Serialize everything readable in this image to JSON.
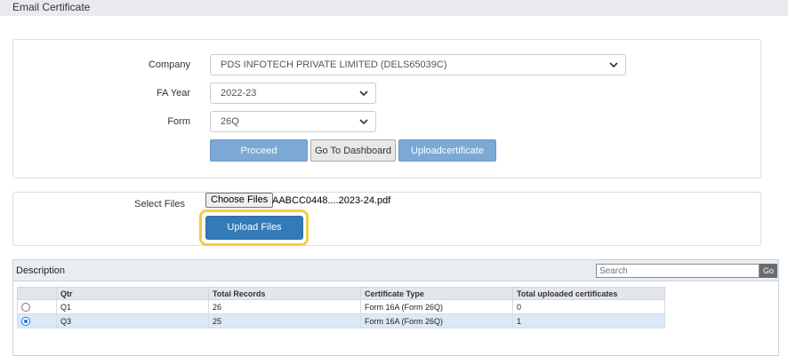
{
  "header": {
    "title": "Email Certificate"
  },
  "form": {
    "company_label": "Company",
    "company_value": "PDS INFOTECH PRIVATE LIMITED (DELS65039C)",
    "fa_year_label": "FA Year",
    "fa_year_value": "2022-23",
    "form_label": "Form",
    "form_value": "26Q",
    "proceed_label": "Proceed",
    "dashboard_label": "Go To Dashboard",
    "uploadcert_label": "Uploadcertificate"
  },
  "upload": {
    "select_files_label": "Select Files",
    "choose_files_label": "Choose Files",
    "file_name": "AABCC0448....2023-24.pdf",
    "upload_files_label": "Upload Files"
  },
  "grid": {
    "title": "Description",
    "search_placeholder": "Search",
    "go_label": "Go",
    "columns": [
      "Qtr",
      "Total Records",
      "Certificate Type",
      "Total uploaded certificates"
    ],
    "rows": [
      {
        "qtr": "Q1",
        "total_records": "26",
        "certificate_type": "Form 16A (Form 26Q)",
        "uploaded": "0",
        "selected": false
      },
      {
        "qtr": "Q3",
        "total_records": "25",
        "certificate_type": "Form 16A (Form 26Q)",
        "uploaded": "1",
        "selected": true
      }
    ]
  },
  "colors": {
    "highlight": "#f2cd4a",
    "primary": "#337ab7",
    "primary_light": "#7ba8d5",
    "selected_row": "#dbe8f6"
  }
}
